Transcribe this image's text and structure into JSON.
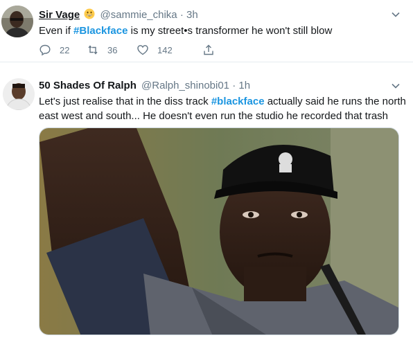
{
  "tweets": [
    {
      "name": "Sir Vage",
      "emoji": "grinning-face",
      "handle": "@sammie_chika",
      "separator": "·",
      "time": "3h",
      "text_before": "Even if ",
      "hashtag": "#Blackface",
      "text_after": " is my street•s transformer he won't still blow",
      "replies": "22",
      "retweets": "36",
      "likes": "142"
    },
    {
      "name": "50 Shades Of Ralph",
      "handle": "@Ralph_shinobi01",
      "separator": "·",
      "time": "1h",
      "text_before": "Let's just realise that in the diss track ",
      "hashtag": "#blackface",
      "text_after": " actually said he runs the north east west and south... He doesn't even run the studio he recorded that trash"
    }
  ],
  "colors": {
    "text": "#14171a",
    "secondary": "#657786",
    "hashtag": "#1b95e0",
    "divider": "#e6ecf0"
  },
  "icons": [
    "reply-icon",
    "retweet-icon",
    "like-icon",
    "share-icon",
    "chevron-down-icon",
    "grinning-face-emoji-icon"
  ]
}
